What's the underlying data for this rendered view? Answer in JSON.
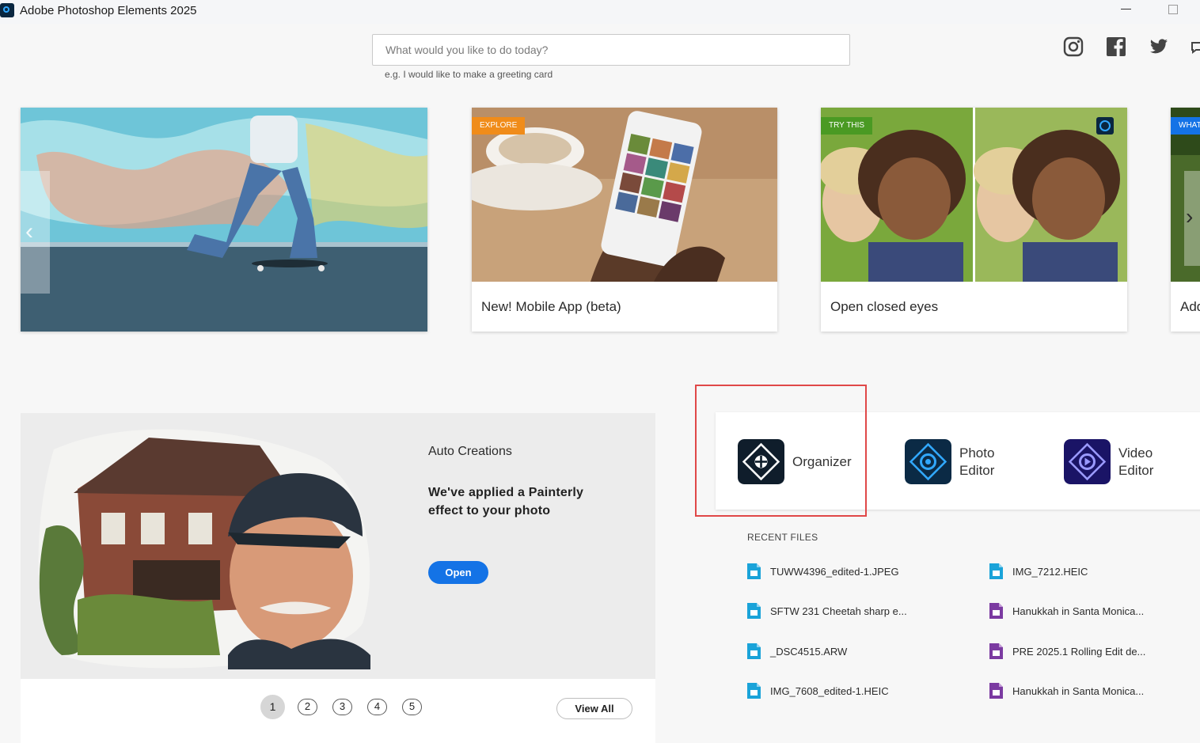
{
  "window": {
    "title": "Adobe Photoshop Elements 2025"
  },
  "search": {
    "placeholder": "What would you like to do today?",
    "hint": "e.g. I would like to make a greeting card"
  },
  "social": [
    "instagram-icon",
    "facebook-icon",
    "twitter-icon",
    "feedback-icon"
  ],
  "carousel": {
    "cards": [
      {
        "tag": "",
        "label": ""
      },
      {
        "tag": "EXPLORE",
        "label": "New! Mobile App (beta)"
      },
      {
        "tag": "TRY THIS",
        "label": "Open closed eyes"
      },
      {
        "tag": "WHAT",
        "label": "Add"
      }
    ]
  },
  "auto_creations": {
    "title": "Auto Creations",
    "description": "We've applied a Painterly effect to your photo",
    "open_label": "Open",
    "pages": [
      "1",
      "2",
      "3",
      "4",
      "5"
    ],
    "active_page": "1",
    "view_all_label": "View All"
  },
  "launch": {
    "organizer": "Organizer",
    "photo_editor_line1": "Photo",
    "photo_editor_line2": "Editor",
    "video_editor_line1": "Video",
    "video_editor_line2": "Editor"
  },
  "recent_files": {
    "title": "RECENT FILES",
    "left": [
      "TUWW4396_edited-1.JPEG",
      "SFTW 231 Cheetah sharp e...",
      "_DSC4515.ARW",
      "IMG_7608_edited-1.HEIC"
    ],
    "right": [
      "IMG_7212.HEIC",
      "Hanukkah in Santa Monica...",
      "PRE 2025.1 Rolling Edit de...",
      "Hanukkah in Santa Monica..."
    ]
  },
  "colors": {
    "accent": "#1473e6",
    "photo_file": "#1aa3d9",
    "video_file": "#7b3aa1",
    "highlight": "#e04848"
  }
}
